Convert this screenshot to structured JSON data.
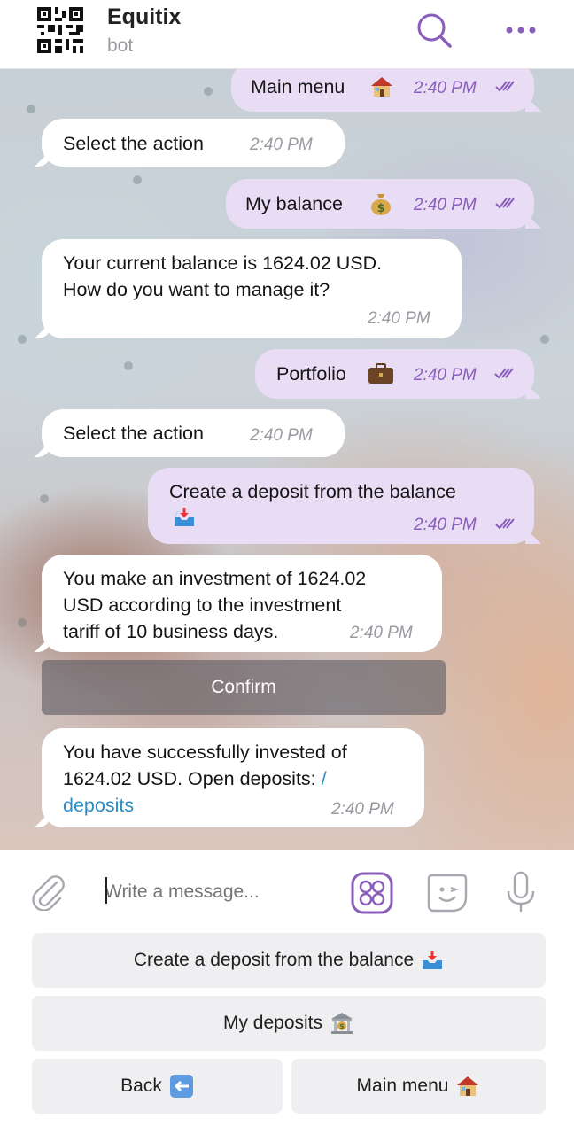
{
  "header": {
    "title": "Equitix",
    "subtitle": "bot"
  },
  "messages": [
    {
      "text": "Main menu",
      "time": "2:40 PM"
    },
    {
      "text": "Select the action",
      "time": "2:40 PM"
    },
    {
      "text": "My balance",
      "time": "2:40 PM"
    },
    {
      "line1": "Your current balance is 1624.02 USD.",
      "line2": "How do you want to manage it?",
      "time": "2:40 PM"
    },
    {
      "text": "Portfolio",
      "time": "2:40 PM"
    },
    {
      "text": "Select the action",
      "time": "2:40 PM"
    },
    {
      "text": "Create a deposit from the balance",
      "time": "2:40 PM"
    },
    {
      "line1": "You make an investment of 1624.02",
      "line2": "USD according to the investment",
      "line3": "tariff of 10 business days.",
      "time": "2:40 PM"
    },
    {
      "line1": "You have successfully invested of",
      "line2": "1624.02 USD. Open deposits:",
      "link_slash": "/",
      "link": "deposits",
      "time": "2:40 PM"
    }
  ],
  "inline_button": {
    "label": "Confirm"
  },
  "composer": {
    "placeholder": "Write a message..."
  },
  "keyboard": {
    "create_deposit": "Create a deposit from the balance",
    "my_deposits": "My deposits",
    "back": "Back",
    "main_menu": "Main menu"
  },
  "colors": {
    "accent": "#8a5dbb",
    "outgoing_bubble": "#e9ddf6",
    "link": "#2c8dc7"
  },
  "icons": [
    "qr-code-icon",
    "search-icon",
    "more-icon",
    "house-icon",
    "money-bag-icon",
    "briefcase-icon",
    "inbox-tray-icon",
    "double-check-icon",
    "paperclip-icon",
    "stickers-icon",
    "emoji-icon",
    "microphone-icon",
    "bank-icon",
    "back-arrow-icon"
  ]
}
